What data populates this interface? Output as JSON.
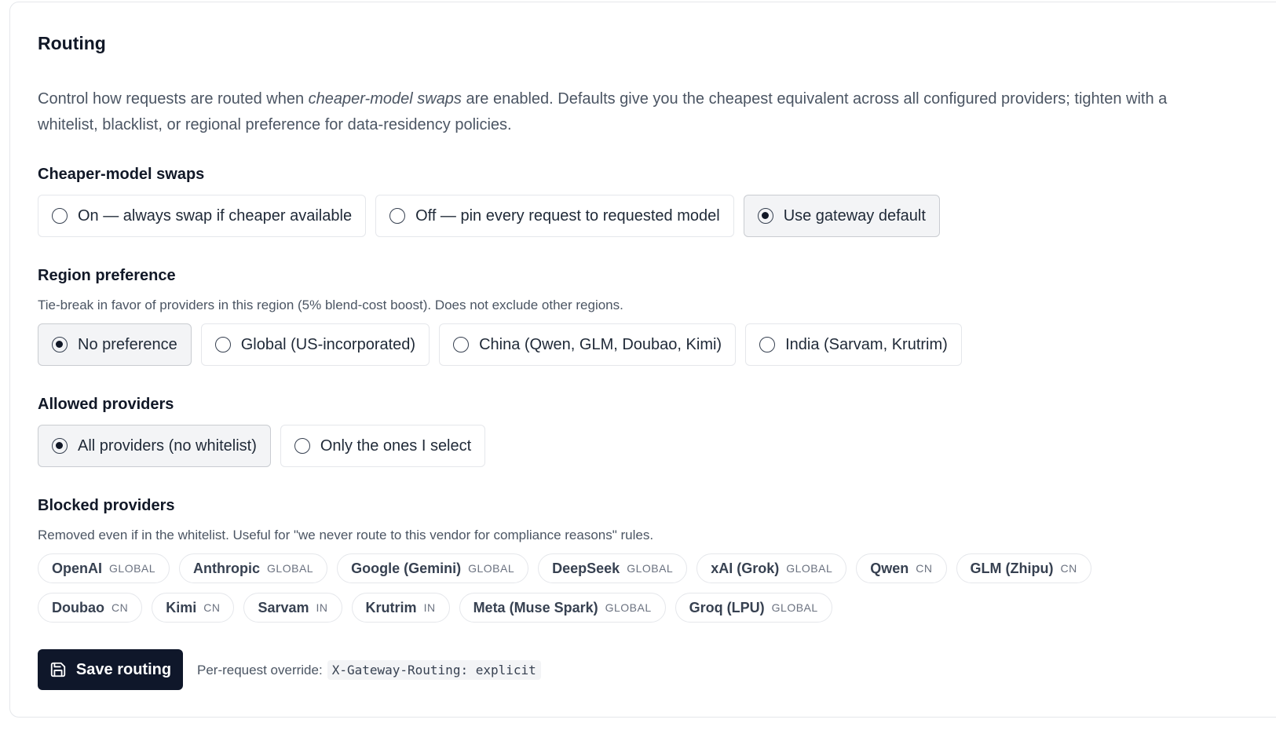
{
  "section": {
    "title": "Routing",
    "description_parts": [
      "Control how requests are routed when ",
      "cheaper-model swaps",
      " are enabled. Defaults give you the cheapest equivalent across all configured providers; tighten with a whitelist, blacklist, or regional preference for data-residency policies."
    ]
  },
  "cheaper_swaps": {
    "label": "Cheaper-model swaps",
    "options": [
      {
        "label": "On — always swap if cheaper available",
        "selected": false
      },
      {
        "label": "Off — pin every request to requested model",
        "selected": false
      },
      {
        "label": "Use gateway default",
        "selected": true
      }
    ]
  },
  "region": {
    "label": "Region preference",
    "hint": "Tie-break in favor of providers in this region (5% blend-cost boost). Does not exclude other regions.",
    "options": [
      {
        "label": "No preference",
        "selected": true
      },
      {
        "label": "Global (US-incorporated)",
        "selected": false
      },
      {
        "label": "China (Qwen, GLM, Doubao, Kimi)",
        "selected": false
      },
      {
        "label": "India (Sarvam, Krutrim)",
        "selected": false
      }
    ]
  },
  "allowed": {
    "label": "Allowed providers",
    "options": [
      {
        "label": "All providers (no whitelist)",
        "selected": true
      },
      {
        "label": "Only the ones I select",
        "selected": false
      }
    ]
  },
  "blocked": {
    "label": "Blocked providers",
    "hint": "Removed even if in the whitelist. Useful for \"we never route to this vendor for compliance reasons\" rules.",
    "providers": [
      {
        "name": "OpenAI",
        "region": "GLOBAL"
      },
      {
        "name": "Anthropic",
        "region": "GLOBAL"
      },
      {
        "name": "Google (Gemini)",
        "region": "GLOBAL"
      },
      {
        "name": "DeepSeek",
        "region": "GLOBAL"
      },
      {
        "name": "xAI (Grok)",
        "region": "GLOBAL"
      },
      {
        "name": "Qwen",
        "region": "CN"
      },
      {
        "name": "GLM (Zhipu)",
        "region": "CN"
      },
      {
        "name": "Doubao",
        "region": "CN"
      },
      {
        "name": "Kimi",
        "region": "CN"
      },
      {
        "name": "Sarvam",
        "region": "IN"
      },
      {
        "name": "Krutrim",
        "region": "IN"
      },
      {
        "name": "Meta (Muse Spark)",
        "region": "GLOBAL"
      },
      {
        "name": "Groq (LPU)",
        "region": "GLOBAL"
      }
    ]
  },
  "footer": {
    "save_label": "Save routing",
    "save_icon": "save-icon",
    "override_label": "Per-request override:",
    "override_code": "X-Gateway-Routing: explicit"
  },
  "colors": {
    "primary_button": "#0f172a",
    "selected_option_bg": "#f3f4f6"
  }
}
